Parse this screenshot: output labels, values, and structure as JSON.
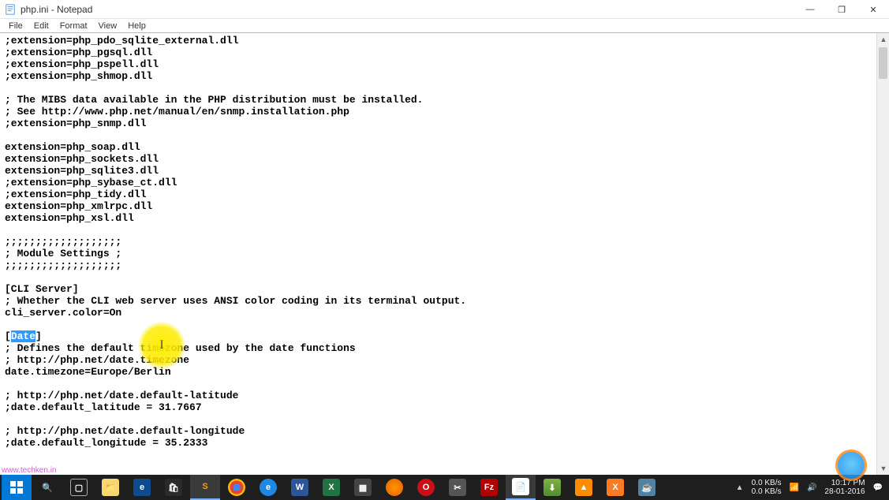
{
  "window": {
    "title": "php.ini - Notepad"
  },
  "menu": {
    "file": "File",
    "edit": "Edit",
    "format": "Format",
    "view": "View",
    "help": "Help"
  },
  "winbtn": {
    "min": "—",
    "max": "❐",
    "close": "✕"
  },
  "editor": {
    "selected": "Date",
    "lines": [
      ";extension=php_pdo_sqlite_external.dll",
      ";extension=php_pgsql.dll",
      ";extension=php_pspell.dll",
      ";extension=php_shmop.dll",
      "",
      "; The MIBS data available in the PHP distribution must be installed.",
      "; See http://www.php.net/manual/en/snmp.installation.php",
      ";extension=php_snmp.dll",
      "",
      "extension=php_soap.dll",
      "extension=php_sockets.dll",
      "extension=php_sqlite3.dll",
      ";extension=php_sybase_ct.dll",
      ";extension=php_tidy.dll",
      "extension=php_xmlrpc.dll",
      "extension=php_xsl.dll",
      "",
      ";;;;;;;;;;;;;;;;;;;",
      "; Module Settings ;",
      ";;;;;;;;;;;;;;;;;;;",
      "",
      "[CLI Server]",
      "; Whether the CLI web server uses ANSI color coding in its terminal output.",
      "cli_server.color=On",
      "",
      "[",
      "]",
      "; Defines the default timezone used by the date functions",
      "; http://php.net/date.timezone",
      "date.timezone=Europe/Berlin",
      "",
      "; http://php.net/date.default-latitude",
      ";date.default_latitude = 31.7667",
      "",
      "; http://php.net/date.default-longitude",
      ";date.default_longitude = 35.2333"
    ]
  },
  "cursor_caret": "I",
  "tray": {
    "net_up": "0.0 KB/s",
    "net_down": "0.0 KB/s",
    "time": "10:17 PM",
    "date": "28-01-2016"
  },
  "watermark": "www.techken.in"
}
